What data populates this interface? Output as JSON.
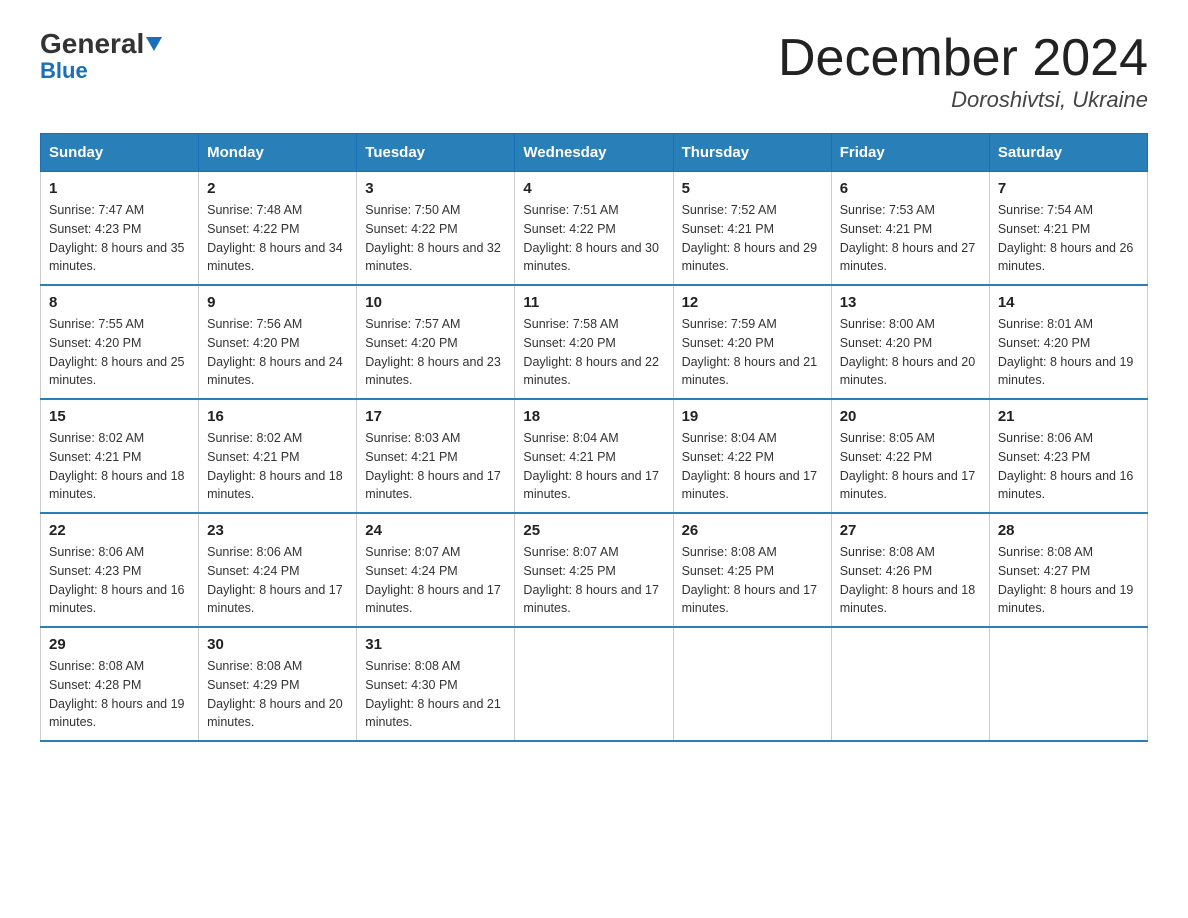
{
  "header": {
    "logo_general": "General",
    "logo_blue": "Blue",
    "title": "December 2024",
    "location": "Doroshivtsi, Ukraine"
  },
  "weekdays": [
    "Sunday",
    "Monday",
    "Tuesday",
    "Wednesday",
    "Thursday",
    "Friday",
    "Saturday"
  ],
  "weeks": [
    [
      {
        "day": "1",
        "sunrise": "7:47 AM",
        "sunset": "4:23 PM",
        "daylight": "8 hours and 35 minutes."
      },
      {
        "day": "2",
        "sunrise": "7:48 AM",
        "sunset": "4:22 PM",
        "daylight": "8 hours and 34 minutes."
      },
      {
        "day": "3",
        "sunrise": "7:50 AM",
        "sunset": "4:22 PM",
        "daylight": "8 hours and 32 minutes."
      },
      {
        "day": "4",
        "sunrise": "7:51 AM",
        "sunset": "4:22 PM",
        "daylight": "8 hours and 30 minutes."
      },
      {
        "day": "5",
        "sunrise": "7:52 AM",
        "sunset": "4:21 PM",
        "daylight": "8 hours and 29 minutes."
      },
      {
        "day": "6",
        "sunrise": "7:53 AM",
        "sunset": "4:21 PM",
        "daylight": "8 hours and 27 minutes."
      },
      {
        "day": "7",
        "sunrise": "7:54 AM",
        "sunset": "4:21 PM",
        "daylight": "8 hours and 26 minutes."
      }
    ],
    [
      {
        "day": "8",
        "sunrise": "7:55 AM",
        "sunset": "4:20 PM",
        "daylight": "8 hours and 25 minutes."
      },
      {
        "day": "9",
        "sunrise": "7:56 AM",
        "sunset": "4:20 PM",
        "daylight": "8 hours and 24 minutes."
      },
      {
        "day": "10",
        "sunrise": "7:57 AM",
        "sunset": "4:20 PM",
        "daylight": "8 hours and 23 minutes."
      },
      {
        "day": "11",
        "sunrise": "7:58 AM",
        "sunset": "4:20 PM",
        "daylight": "8 hours and 22 minutes."
      },
      {
        "day": "12",
        "sunrise": "7:59 AM",
        "sunset": "4:20 PM",
        "daylight": "8 hours and 21 minutes."
      },
      {
        "day": "13",
        "sunrise": "8:00 AM",
        "sunset": "4:20 PM",
        "daylight": "8 hours and 20 minutes."
      },
      {
        "day": "14",
        "sunrise": "8:01 AM",
        "sunset": "4:20 PM",
        "daylight": "8 hours and 19 minutes."
      }
    ],
    [
      {
        "day": "15",
        "sunrise": "8:02 AM",
        "sunset": "4:21 PM",
        "daylight": "8 hours and 18 minutes."
      },
      {
        "day": "16",
        "sunrise": "8:02 AM",
        "sunset": "4:21 PM",
        "daylight": "8 hours and 18 minutes."
      },
      {
        "day": "17",
        "sunrise": "8:03 AM",
        "sunset": "4:21 PM",
        "daylight": "8 hours and 17 minutes."
      },
      {
        "day": "18",
        "sunrise": "8:04 AM",
        "sunset": "4:21 PM",
        "daylight": "8 hours and 17 minutes."
      },
      {
        "day": "19",
        "sunrise": "8:04 AM",
        "sunset": "4:22 PM",
        "daylight": "8 hours and 17 minutes."
      },
      {
        "day": "20",
        "sunrise": "8:05 AM",
        "sunset": "4:22 PM",
        "daylight": "8 hours and 17 minutes."
      },
      {
        "day": "21",
        "sunrise": "8:06 AM",
        "sunset": "4:23 PM",
        "daylight": "8 hours and 16 minutes."
      }
    ],
    [
      {
        "day": "22",
        "sunrise": "8:06 AM",
        "sunset": "4:23 PM",
        "daylight": "8 hours and 16 minutes."
      },
      {
        "day": "23",
        "sunrise": "8:06 AM",
        "sunset": "4:24 PM",
        "daylight": "8 hours and 17 minutes."
      },
      {
        "day": "24",
        "sunrise": "8:07 AM",
        "sunset": "4:24 PM",
        "daylight": "8 hours and 17 minutes."
      },
      {
        "day": "25",
        "sunrise": "8:07 AM",
        "sunset": "4:25 PM",
        "daylight": "8 hours and 17 minutes."
      },
      {
        "day": "26",
        "sunrise": "8:08 AM",
        "sunset": "4:25 PM",
        "daylight": "8 hours and 17 minutes."
      },
      {
        "day": "27",
        "sunrise": "8:08 AM",
        "sunset": "4:26 PM",
        "daylight": "8 hours and 18 minutes."
      },
      {
        "day": "28",
        "sunrise": "8:08 AM",
        "sunset": "4:27 PM",
        "daylight": "8 hours and 19 minutes."
      }
    ],
    [
      {
        "day": "29",
        "sunrise": "8:08 AM",
        "sunset": "4:28 PM",
        "daylight": "8 hours and 19 minutes."
      },
      {
        "day": "30",
        "sunrise": "8:08 AM",
        "sunset": "4:29 PM",
        "daylight": "8 hours and 20 minutes."
      },
      {
        "day": "31",
        "sunrise": "8:08 AM",
        "sunset": "4:30 PM",
        "daylight": "8 hours and 21 minutes."
      },
      null,
      null,
      null,
      null
    ]
  ]
}
